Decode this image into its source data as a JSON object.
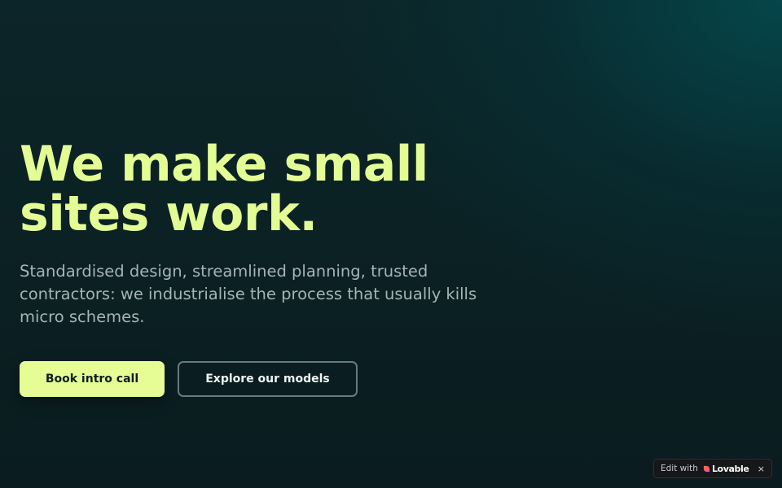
{
  "hero": {
    "headline_line1": "We make small",
    "headline_line2": "sites work.",
    "subheading": "Standardised design, streamlined planning, trusted contractors: we industrialise the process that usually kills micro schemes.",
    "primary_cta_label": "Book intro call",
    "secondary_cta_label": "Explore our models"
  },
  "badge": {
    "edit_label": "Edit with",
    "brand_name": "Lovable",
    "close_label": "×",
    "heart_icon": "heart-icon",
    "heart_colors": [
      "#ff5a6e",
      "#ff7a3c",
      "#e64bd6"
    ]
  },
  "colors": {
    "accent": "#e6fd95",
    "headline": "#e3fd94",
    "body_text": "#a6b4b5",
    "background_dark": "#0b1f22",
    "background_glow": "#04484c"
  }
}
